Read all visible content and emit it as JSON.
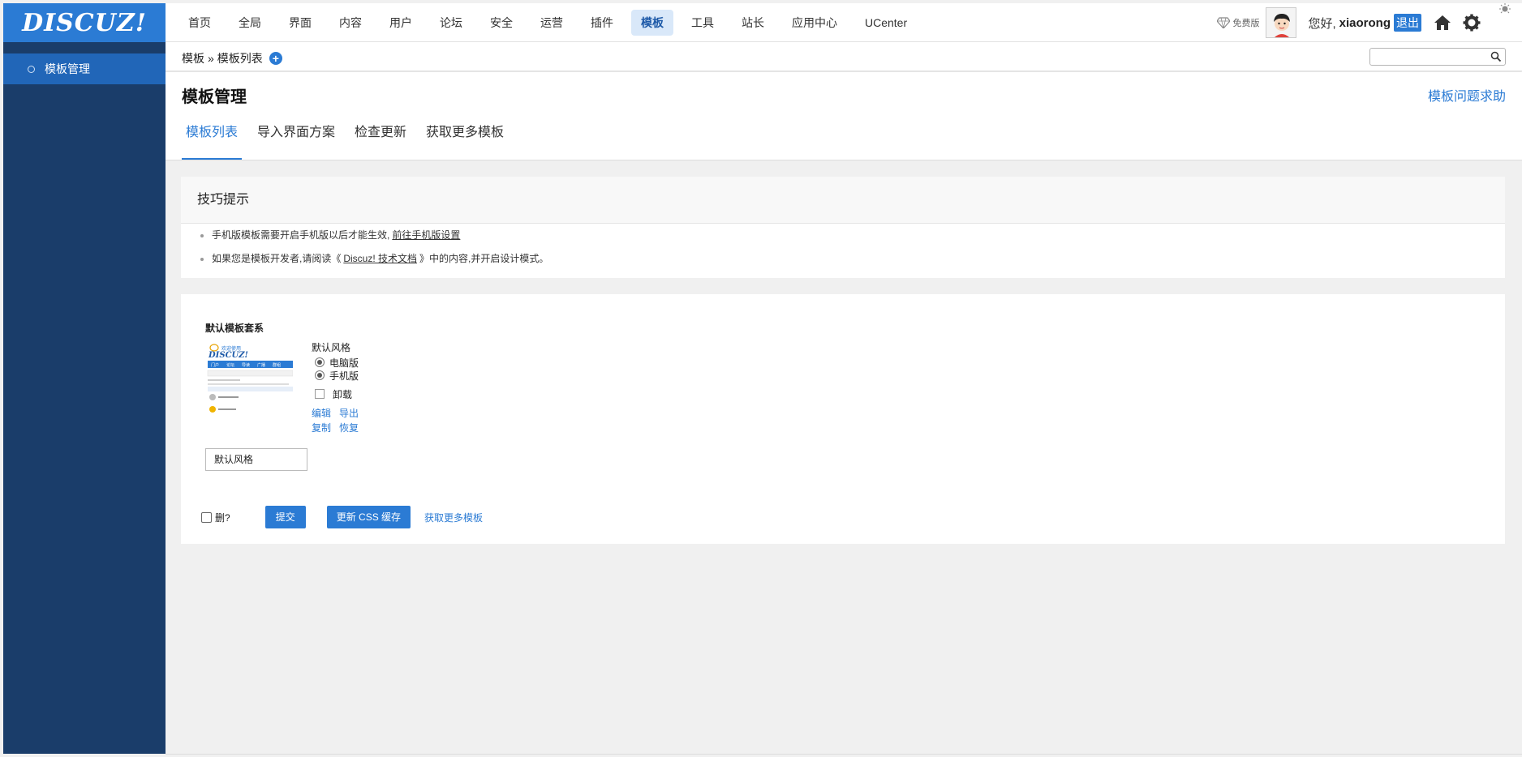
{
  "logo": {
    "text": "DISCUZ!"
  },
  "sidebar": {
    "items": [
      {
        "label": "模板管理"
      }
    ]
  },
  "topnav": {
    "items": [
      {
        "label": "首页"
      },
      {
        "label": "全局"
      },
      {
        "label": "界面"
      },
      {
        "label": "内容"
      },
      {
        "label": "用户"
      },
      {
        "label": "论坛"
      },
      {
        "label": "安全"
      },
      {
        "label": "运营"
      },
      {
        "label": "插件"
      },
      {
        "label": "模板"
      },
      {
        "label": "工具"
      },
      {
        "label": "站长"
      },
      {
        "label": "应用中心"
      },
      {
        "label": "UCenter"
      }
    ],
    "active": "模板"
  },
  "user": {
    "edition": "免费版",
    "greeting": "您好,",
    "name": "xiaorong",
    "logout": "退出"
  },
  "icons": {
    "home": "home-icon",
    "settings": "gear-icon",
    "theme": "sun-moon-icon",
    "edition": "diamond-icon",
    "search": "search-icon",
    "add": "plus-icon"
  },
  "breadcrumb": {
    "root": "模板",
    "separator": "»",
    "current": "模板列表",
    "add": "+"
  },
  "search": {
    "value": "",
    "placeholder": ""
  },
  "page": {
    "title": "模板管理",
    "help_link": "模板问题求助"
  },
  "tabs": [
    {
      "label": "模板列表"
    },
    {
      "label": "导入界面方案"
    },
    {
      "label": "检查更新"
    },
    {
      "label": "获取更多模板"
    }
  ],
  "tips": {
    "title": "技巧提示",
    "line1": {
      "text": "手机版模板需要开启手机版以后才能生效,",
      "link": "前往手机版设置"
    },
    "line2": {
      "prefix": "如果您是模板开发者,请阅读《",
      "link": "Discuz! 技术文档",
      "suffix": "》中的内容,并开启设计模式。"
    }
  },
  "template": {
    "set_name": "默认模板套系",
    "thumb_texts": {
      "brand": "DISCUZ!",
      "slogan": "欢迎使用",
      "nav": [
        "门户",
        "论坛",
        "导读",
        "广播",
        "群组"
      ]
    },
    "style_name": "默认风格",
    "pc_label": "电脑版",
    "mobile_label": "手机版",
    "uninstall_label": "卸载",
    "edit": "编辑",
    "export": "导出",
    "copy": "复制",
    "restore": "恢复",
    "name_value": "默认风格"
  },
  "actions": {
    "delete_label": "删?",
    "submit": "提交",
    "update_css": "更新 CSS 缓存",
    "more_link": "获取更多模板"
  },
  "colors": {
    "accent": "#2b7bd4",
    "sidebar": "#1a3d6a",
    "sidebar_active": "#2166b8"
  }
}
